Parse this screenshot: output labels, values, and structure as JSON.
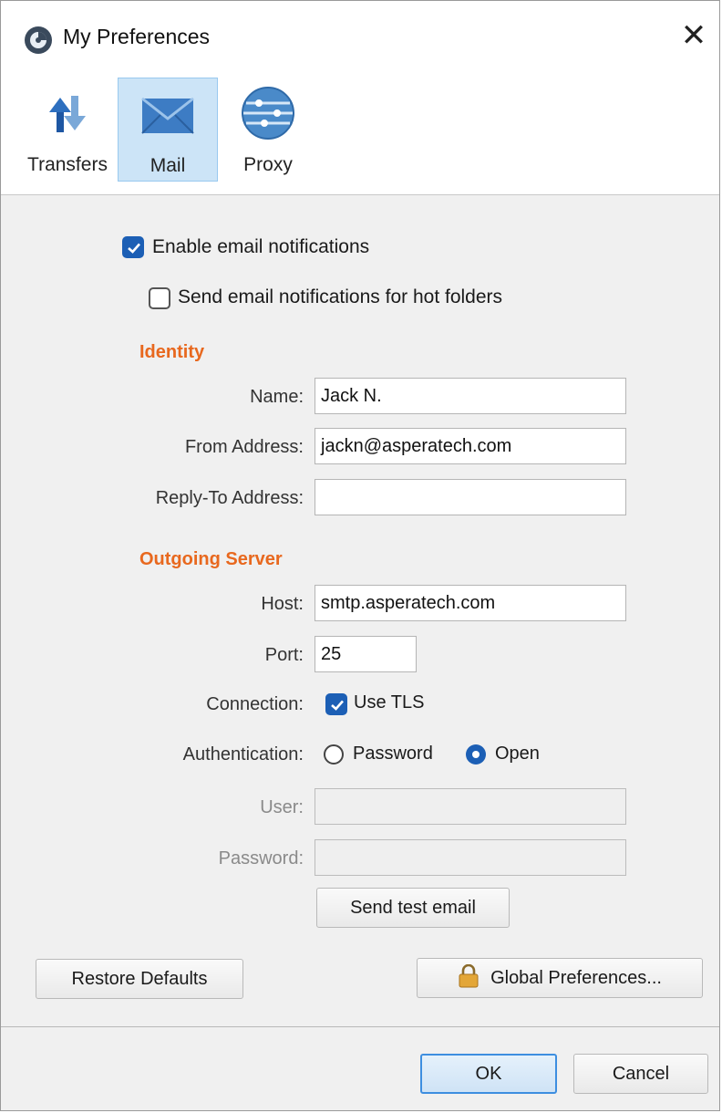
{
  "window": {
    "title": "My Preferences",
    "close_icon": "close-icon"
  },
  "toolbar": {
    "tabs": [
      {
        "label": "Transfers",
        "icon": "transfers-icon",
        "selected": false
      },
      {
        "label": "Mail",
        "icon": "mail-icon",
        "selected": true
      },
      {
        "label": "Proxy",
        "icon": "proxy-icon",
        "selected": false
      }
    ]
  },
  "notifications": {
    "enable_label": "Enable email notifications",
    "enable_checked": true,
    "hot_folders_label": "Send email notifications for hot folders",
    "hot_folders_checked": false
  },
  "identity": {
    "section_title": "Identity",
    "name_label": "Name:",
    "name_value": "Jack N.",
    "from_label": "From Address:",
    "from_value": "jackn@asperatech.com",
    "reply_label": "Reply-To Address:",
    "reply_value": ""
  },
  "outgoing": {
    "section_title": "Outgoing Server",
    "host_label": "Host:",
    "host_value": "smtp.asperatech.com",
    "port_label": "Port:",
    "port_value": "25",
    "connection_label": "Connection:",
    "tls_label": "Use TLS",
    "tls_checked": true,
    "auth_label": "Authentication:",
    "auth_options": [
      {
        "label": "Password",
        "selected": false
      },
      {
        "label": "Open",
        "selected": true
      }
    ],
    "user_label": "User:",
    "user_value": "",
    "password_label": "Password:",
    "password_value": "",
    "test_button": "Send test email"
  },
  "buttons": {
    "restore_defaults": "Restore Defaults",
    "global_preferences": "Global Preferences...",
    "ok": "OK",
    "cancel": "Cancel"
  },
  "colors": {
    "accent": "#1c5fb5",
    "section_title": "#e8681e",
    "selected_tab": "#cce4f7"
  }
}
